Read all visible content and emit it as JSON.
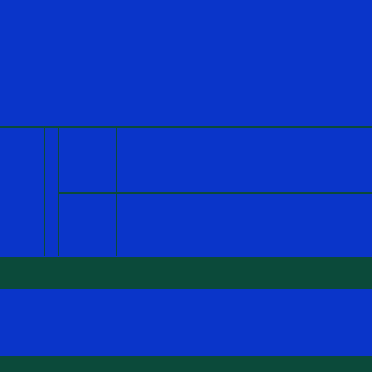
{
  "toolbar": {
    "lines": [
      "",
      "",
      "",
      ""
    ],
    "command": ""
  },
  "header": {
    "tabs": [
      "",
      "",
      "",
      "",
      "",
      "",
      "",
      "",
      ""
    ],
    "info_row": [
      "",
      "",
      "",
      "",
      "",
      "",
      "",
      "",
      ""
    ],
    "stats_row_1": [
      "",
      "",
      "",
      "",
      "",
      "",
      "",
      "",
      ""
    ],
    "stats_row_2": [
      "",
      "",
      "",
      "",
      "",
      "",
      "",
      "",
      ""
    ]
  },
  "grid": {
    "column_headers": [
      "",
      "",
      "",
      "",
      "",
      "",
      "",
      "",
      ""
    ],
    "row_labels": [
      "",
      "",
      "",
      "",
      "",
      "",
      "",
      "",
      "",
      "",
      ""
    ]
  },
  "bottom": {
    "heading": "",
    "detail_lines": [
      "",
      "",
      ""
    ]
  },
  "status_bar": {
    "text": ""
  }
}
